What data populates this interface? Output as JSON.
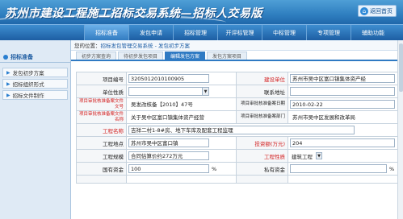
{
  "app": {
    "title": "苏州市建设工程施工招标交易系统—招标人交易版",
    "home_label": "返回首页",
    "accent": "#2f7ac3"
  },
  "nav": {
    "items": [
      "招标准备",
      "发包申请",
      "招标管理",
      "开评标管理",
      "中标管理",
      "专项管理",
      "辅助功能"
    ],
    "active": 0
  },
  "sidebar": {
    "header": "招标准备",
    "items": [
      "发包初步方案",
      "招标组织形式",
      "招标文件制作"
    ]
  },
  "breadcrumb": {
    "prefix": "您的位置：",
    "path": "招标发包管理交易系统 - 发包初步方案"
  },
  "tabs": [
    {
      "label": "初步方案查询"
    },
    {
      "label": "待初步发包项目"
    },
    {
      "label": "编辑发包方案",
      "active": true
    },
    {
      "label": "发包方案项目"
    }
  ],
  "form": {
    "project_code": {
      "label": "项目编号",
      "value": "3205012010100905"
    },
    "builder": {
      "label": "建设单位",
      "value": "苏州市吴中区富口镇集体资产经"
    },
    "unit_nature": {
      "label": "单位性质",
      "value": ""
    },
    "contact_addr": {
      "label": "联系地址",
      "value": ""
    },
    "approval_doc_no": {
      "label": "项目审批核准备案文件文号",
      "value": "吴发改核备【2010】47号"
    },
    "approval_date": {
      "label": "项目审批核准备案日期",
      "value": "2010-02-22"
    },
    "approval_doc_name": {
      "label": "项目审批核准备案文件名称",
      "value": "关于吴中区富口镇集体资产经营"
    },
    "approval_authority": {
      "label": "项目审批核准备案部门",
      "value": "苏州市吴中区发展和改革局"
    },
    "project_name": {
      "label": "工程名称",
      "value": "吉祥二村1-8#房、地下车库及配套工程监理"
    },
    "location": {
      "label": "工程地点",
      "value": "苏州市吴中区富口镇"
    },
    "investment": {
      "label": "投资额(万元)",
      "value": "204"
    },
    "scale": {
      "label": "工程规模",
      "value": "合同估算价约272万元"
    },
    "project_type": {
      "label": "工程性质",
      "value": "建筑工程"
    },
    "state_funds": {
      "label": "国有资金",
      "value": "100",
      "unit": "%"
    },
    "private_funds": {
      "label": "私有资金",
      "value": "",
      "unit": "%"
    }
  }
}
